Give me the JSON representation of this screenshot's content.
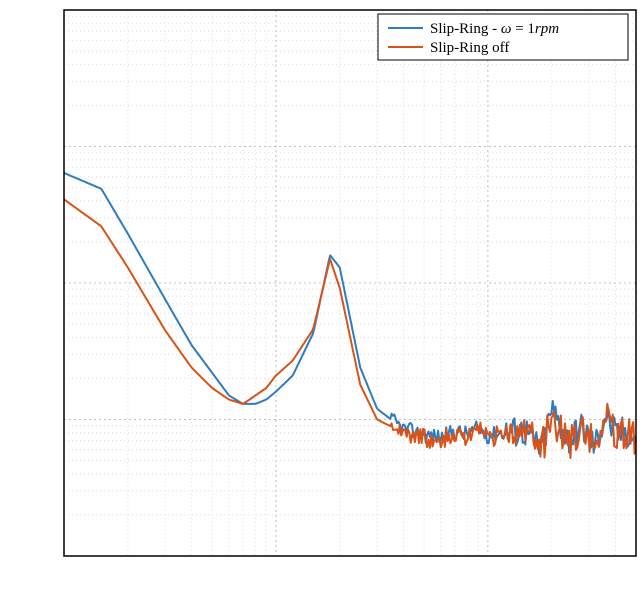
{
  "chart_data": {
    "type": "line",
    "xscale": "log",
    "yscale": "log",
    "xlim": [
      1,
      500
    ],
    "ylim": [
      1e-06,
      0.01
    ],
    "xlabel": "",
    "ylabel": "",
    "title": "",
    "grid": true,
    "legend_position": "top-right",
    "series": [
      {
        "name": "Slip-Ring - ω = 1rpm",
        "color": "#2f7bbf",
        "x": [
          1,
          1.5,
          2,
          3,
          4,
          5,
          6,
          7,
          8,
          9,
          10,
          12,
          15,
          18,
          20,
          25,
          30,
          40,
          50,
          60,
          70,
          80,
          90,
          100,
          120,
          150,
          180,
          200,
          240,
          280,
          320,
          360,
          400,
          450,
          500
        ],
        "y": [
          0.00064,
          0.00049,
          0.00023,
          7.6e-05,
          3.5e-05,
          2.2e-05,
          1.5e-05,
          1.3e-05,
          1.3e-05,
          1.4e-05,
          1.6e-05,
          2.1e-05,
          4.3e-05,
          0.00016,
          0.00013,
          2.4e-05,
          1.2e-05,
          8.5e-06,
          7.7e-06,
          7.4e-06,
          8.2e-06,
          7.8e-06,
          8.6e-06,
          7.6e-06,
          8.1e-06,
          8.3e-06,
          6.1e-06,
          1.2e-05,
          7.2e-06,
          8.8e-06,
          6.4e-06,
          1.1e-05,
          7.7e-06,
          8.4e-06,
          7.2e-06
        ]
      },
      {
        "name": "Slip-Ring off",
        "color": "#d95319",
        "x": [
          1,
          1.5,
          2,
          3,
          4,
          5,
          6,
          7,
          8,
          9,
          10,
          12,
          15,
          18,
          20,
          25,
          30,
          40,
          50,
          60,
          70,
          80,
          90,
          100,
          120,
          150,
          180,
          200,
          240,
          280,
          320,
          360,
          400,
          450,
          500
        ],
        "y": [
          0.00041,
          0.00026,
          0.00013,
          4.5e-05,
          2.4e-05,
          1.7e-05,
          1.4e-05,
          1.3e-05,
          1.5e-05,
          1.7e-05,
          2.1e-05,
          2.7e-05,
          4.6e-05,
          0.00015,
          9.2e-05,
          1.8e-05,
          1e-05,
          8e-06,
          7.4e-06,
          7.1e-06,
          7.8e-06,
          7.4e-06,
          8.6e-06,
          7.2e-06,
          7.6e-06,
          8.2e-06,
          6.3e-06,
          1.1e-05,
          6.6e-06,
          8.8e-06,
          6.1e-06,
          1.1e-05,
          7.6e-06,
          8e-06,
          6.9e-06
        ]
      }
    ]
  },
  "legend": {
    "items": [
      {
        "label_prefix": "Slip-Ring - ",
        "omega": "ω",
        "eq": " = 1",
        "unit": "rpm"
      },
      {
        "label_plain": "Slip-Ring off"
      }
    ]
  }
}
